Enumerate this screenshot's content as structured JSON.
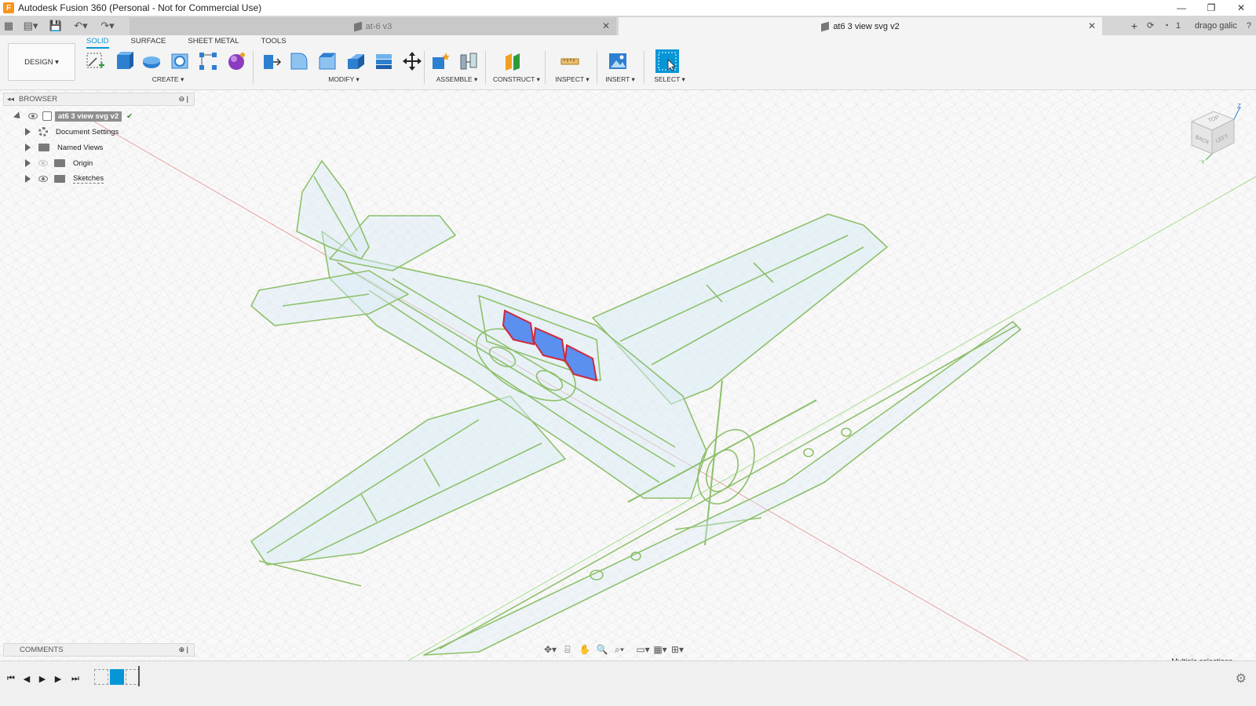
{
  "window": {
    "title": "Autodesk Fusion 360 (Personal - Not for Commercial Use)",
    "app_icon": "F"
  },
  "tabs": {
    "inactive_label": "at-6 v3",
    "active_label": "at6 3 view svg v2",
    "user": "drago galic",
    "jobs": "1"
  },
  "ribbon": {
    "design_label": "DESIGN ▾",
    "tabs": [
      "SOLID",
      "SURFACE",
      "SHEET METAL",
      "TOOLS"
    ],
    "groups": {
      "create": "CREATE ▾",
      "modify": "MODIFY ▾",
      "assemble": "ASSEMBLE ▾",
      "construct": "CONSTRUCT ▾",
      "inspect": "INSPECT ▾",
      "insert": "INSERT ▾",
      "select": "SELECT ▾"
    }
  },
  "browser": {
    "header": "BROWSER",
    "root": "at6 3 view svg v2",
    "items": [
      {
        "label": "Document Settings",
        "icon": "gear-icon"
      },
      {
        "label": "Named Views",
        "icon": "folder-icon"
      },
      {
        "label": "Origin",
        "icon": "folder-icon"
      },
      {
        "label": "Sketches",
        "icon": "folder-icon"
      }
    ]
  },
  "comments": {
    "header": "COMMENTS"
  },
  "status": {
    "selection": "Multiple selections"
  },
  "viewcube": {
    "top": "TOP",
    "back": "BACK",
    "left": "LEFT",
    "z": "Z",
    "y": "Y"
  },
  "colors": {
    "accent": "#0696d7",
    "sketch_line": "#8dc06a",
    "sketch_fill": "#d9ecf6",
    "selection_fill": "#5b8ff0",
    "selection_stroke": "#d0283a",
    "axis_red": "#e05050",
    "axis_green": "#8dd070"
  }
}
